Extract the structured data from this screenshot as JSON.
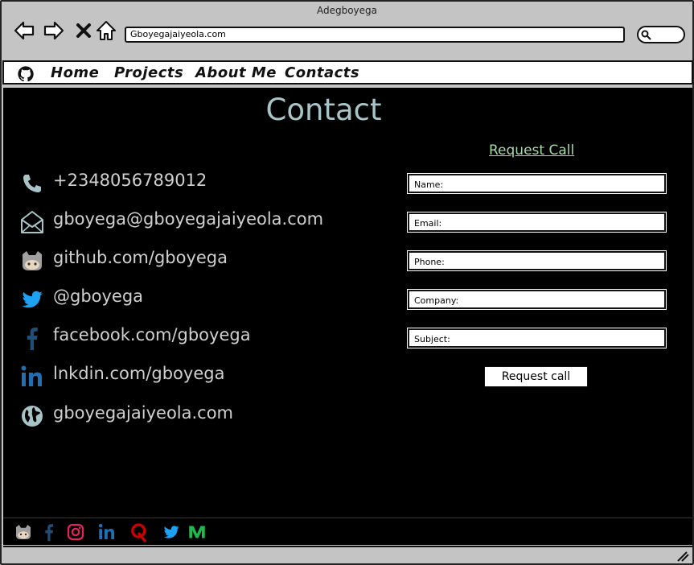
{
  "window": {
    "title": "Adegboyega"
  },
  "browser": {
    "url": "Gboyegajaiyeola.com",
    "nav_icons": [
      "back-arrow-icon",
      "forward-arrow-icon",
      "close-icon",
      "home-icon"
    ]
  },
  "menu": {
    "logo_icon": "github-icon",
    "items": [
      {
        "label": "Home"
      },
      {
        "label": "Projects"
      },
      {
        "label": "About Me"
      },
      {
        "label": "Contacts"
      }
    ]
  },
  "page": {
    "title": "Contact"
  },
  "contacts": [
    {
      "icon": "phone-icon",
      "text": "+2348056789012"
    },
    {
      "icon": "email-icon",
      "text": "gboyega@gboyegajaiyeola.com"
    },
    {
      "icon": "github-icon",
      "text": "github.com/gboyega"
    },
    {
      "icon": "twitter-icon",
      "text": "@gboyega"
    },
    {
      "icon": "facebook-icon",
      "text": "facebook.com/gboyega"
    },
    {
      "icon": "linkedin-icon",
      "text": "lnkdin.com/gboyega"
    },
    {
      "icon": "globe-icon",
      "text": "gboyegajaiyeola.com"
    }
  ],
  "form": {
    "title": "Request Call",
    "fields": [
      {
        "placeholder": "Name:",
        "value": ""
      },
      {
        "placeholder": "Email:",
        "value": ""
      },
      {
        "placeholder": "Phone:",
        "value": ""
      },
      {
        "placeholder": "Company:",
        "value": ""
      },
      {
        "placeholder": "Subject:",
        "value": ""
      }
    ],
    "submit_label": "Request call"
  },
  "footer": {
    "icons": [
      "github-icon",
      "facebook-icon",
      "instagram-icon",
      "linkedin-icon",
      "quora-icon",
      "twitter-icon",
      "medium-icon"
    ]
  },
  "colors": {
    "content_bg": "#000000",
    "title": "#a9c4c7",
    "contact_text": "#d0d0d0",
    "form_title": "#a8d8a8",
    "twitter": "#1da1f2",
    "facebook": "#1f4e79",
    "linkedin": "#1f6fb2",
    "instagram": "#e0245e",
    "quora": "#cc0000",
    "medium": "#1fb84a"
  }
}
